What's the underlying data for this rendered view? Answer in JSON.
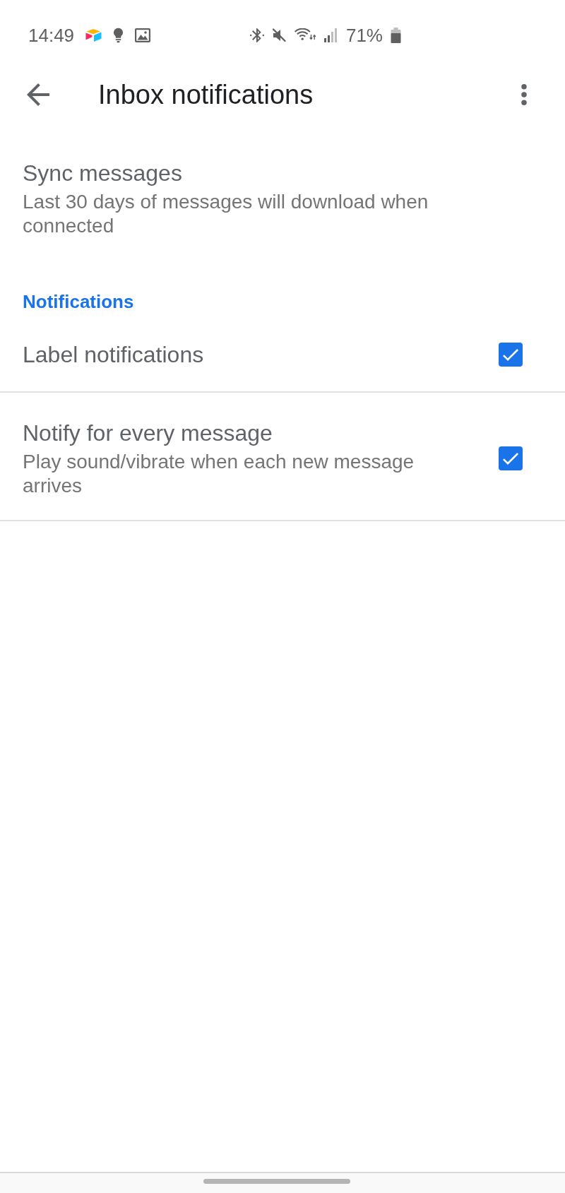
{
  "status_bar": {
    "time": "14:49",
    "battery": "71%"
  },
  "app_bar": {
    "title": "Inbox notifications"
  },
  "settings": [
    {
      "kind": "preference",
      "title": "Sync messages",
      "summary": "Last 30 days of messages will download when connected"
    },
    {
      "kind": "category",
      "title": "Notifications"
    },
    {
      "kind": "checkbox",
      "title": "Label notifications",
      "checked": true
    },
    {
      "kind": "checkbox",
      "title": "Notify for every message",
      "summary": "Play sound/vibrate when each new message arrives",
      "checked": true
    }
  ]
}
